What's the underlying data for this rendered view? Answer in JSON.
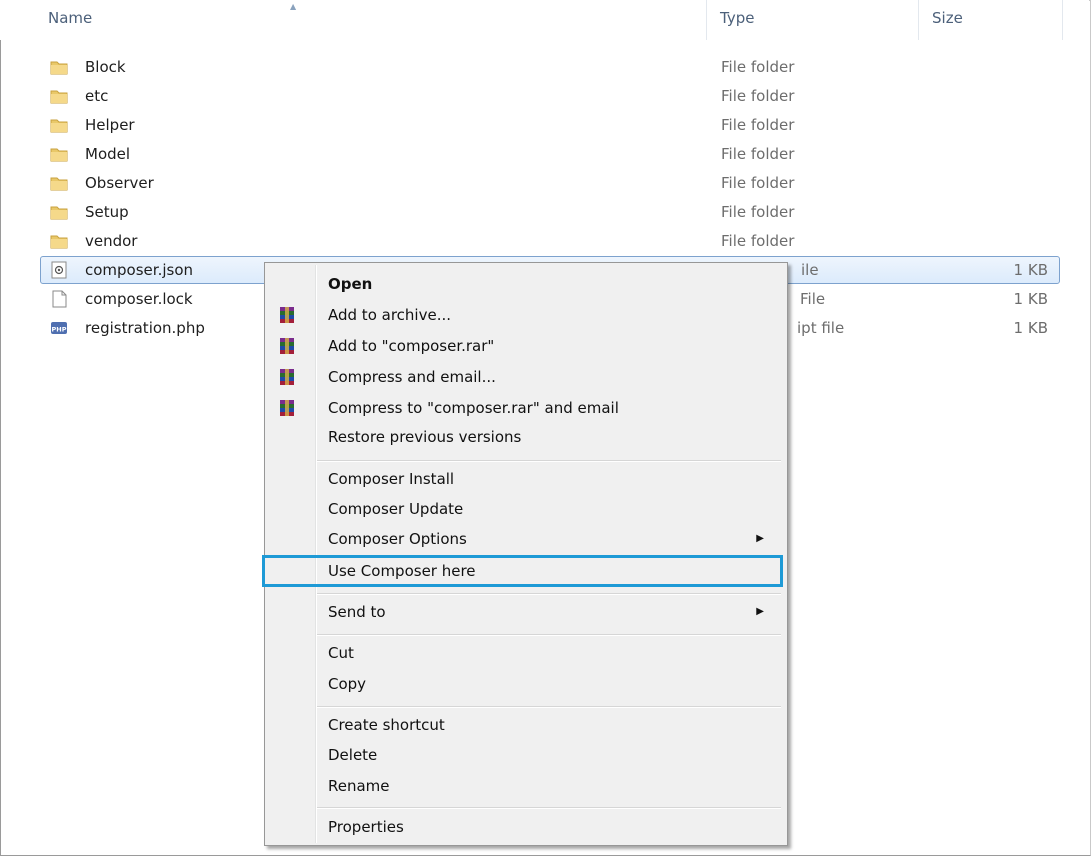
{
  "columns": {
    "name": "Name",
    "type": "Type",
    "size": "Size"
  },
  "files": [
    {
      "name": "Block",
      "type": "File folder",
      "size": "",
      "icon": "folder-icon"
    },
    {
      "name": "etc",
      "type": "File folder",
      "size": "",
      "icon": "folder-icon"
    },
    {
      "name": "Helper",
      "type": "File folder",
      "size": "",
      "icon": "folder-icon"
    },
    {
      "name": "Model",
      "type": "File folder",
      "size": "",
      "icon": "folder-icon"
    },
    {
      "name": "Observer",
      "type": "File folder",
      "size": "",
      "icon": "folder-icon"
    },
    {
      "name": "Setup",
      "type": "File folder",
      "size": "",
      "icon": "folder-icon"
    },
    {
      "name": "vendor",
      "type": "File folder",
      "size": "",
      "icon": "folder-icon"
    },
    {
      "name": "composer.json",
      "type": "ile",
      "size": "1 KB",
      "icon": "json-file-icon",
      "selected": true
    },
    {
      "name": "composer.lock",
      "type": "File",
      "size": "1 KB",
      "icon": "blank-file-icon"
    },
    {
      "name": "registration.php",
      "type": "ipt file",
      "size": "1 KB",
      "icon": "php-file-icon"
    }
  ],
  "context_menu": {
    "items": [
      {
        "label": "Open",
        "bold": true
      },
      {
        "label": "Add to archive...",
        "icon": "winrar-icon"
      },
      {
        "label": "Add to \"composer.rar\"",
        "icon": "winrar-icon"
      },
      {
        "label": "Compress and email...",
        "icon": "winrar-icon"
      },
      {
        "label": "Compress to \"composer.rar\" and email",
        "icon": "winrar-icon"
      },
      {
        "label": "Restore previous versions"
      },
      {
        "label": "Composer Install"
      },
      {
        "label": "Composer Update"
      },
      {
        "label": "Composer Options",
        "submenu": true
      },
      {
        "label": "Use Composer here",
        "highlighted": true
      },
      {
        "label": "Send to",
        "submenu": true
      },
      {
        "label": "Cut"
      },
      {
        "label": "Copy"
      },
      {
        "label": "Create shortcut"
      },
      {
        "label": "Delete"
      },
      {
        "label": "Rename"
      },
      {
        "label": "Properties"
      }
    ]
  },
  "colors": {
    "highlight_border": "#1e9ad6",
    "selection_border": "#7da2ce",
    "menu_background": "#f0f0f0"
  }
}
